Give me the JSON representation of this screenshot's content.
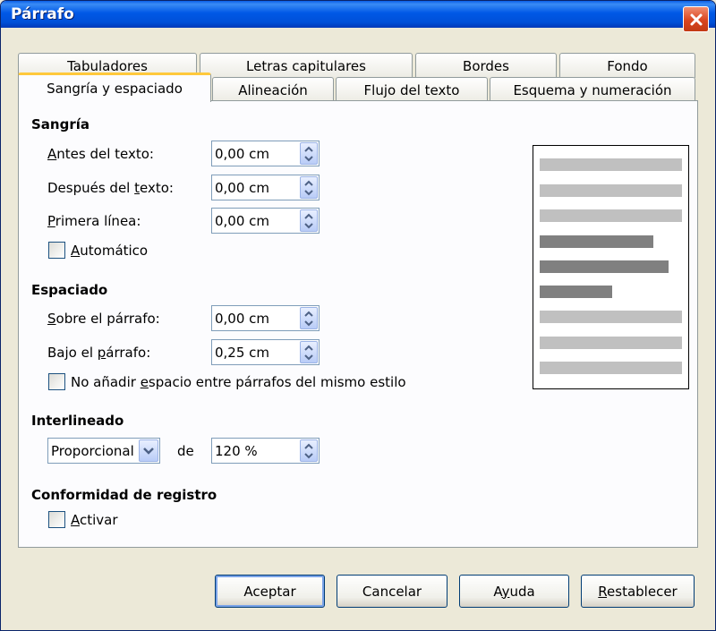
{
  "window": {
    "title": "Párrafo"
  },
  "tabs": {
    "back": [
      "Tabuladores",
      "Letras capitulares",
      "Bordes",
      "Fondo"
    ],
    "front": [
      "Sangría y espaciado",
      "Alineación",
      "Flujo del texto",
      "Esquema y numeración"
    ]
  },
  "indent": {
    "title": "Sangría",
    "before_label_u": "A",
    "before_label_rest": "ntes del texto:",
    "before_value": "0,00 cm",
    "after_label_a": "Después del ",
    "after_label_u": "t",
    "after_label_rest": "exto:",
    "after_value": "0,00 cm",
    "first_label_u": "P",
    "first_label_rest": "rimera línea:",
    "first_value": "0,00 cm",
    "auto_label_u": "A",
    "auto_label_rest": "utomático"
  },
  "spacing": {
    "title": "Espaciado",
    "above_label_u": "S",
    "above_label_rest": "obre el párrafo:",
    "above_value": "0,00 cm",
    "below_label_a": "Bajo el ",
    "below_label_u": "p",
    "below_label_rest": "árrafo:",
    "below_value": "0,25 cm",
    "noadd_label_a": "No añadir ",
    "noadd_label_u": "e",
    "noadd_label_rest": "spacio entre párrafos del mismo estilo"
  },
  "linespacing": {
    "title": "Interlineado",
    "mode": "Proporcional",
    "of_label": "de",
    "value": "120 %"
  },
  "register": {
    "title": "Conformidad de registro",
    "activate_label_u": "A",
    "activate_label_rest": "ctivar"
  },
  "buttons": {
    "ok": "Aceptar",
    "cancel": "Cancelar",
    "help_a": "A",
    "help_u": "y",
    "help_rest": "uda",
    "reset_u": "R",
    "reset_rest": "establecer"
  },
  "colors": {
    "title_bar": "#0058e6",
    "active_tab_accent": "#ffc83c",
    "preview_light": "#c0c0c0",
    "preview_dark": "#808080"
  }
}
